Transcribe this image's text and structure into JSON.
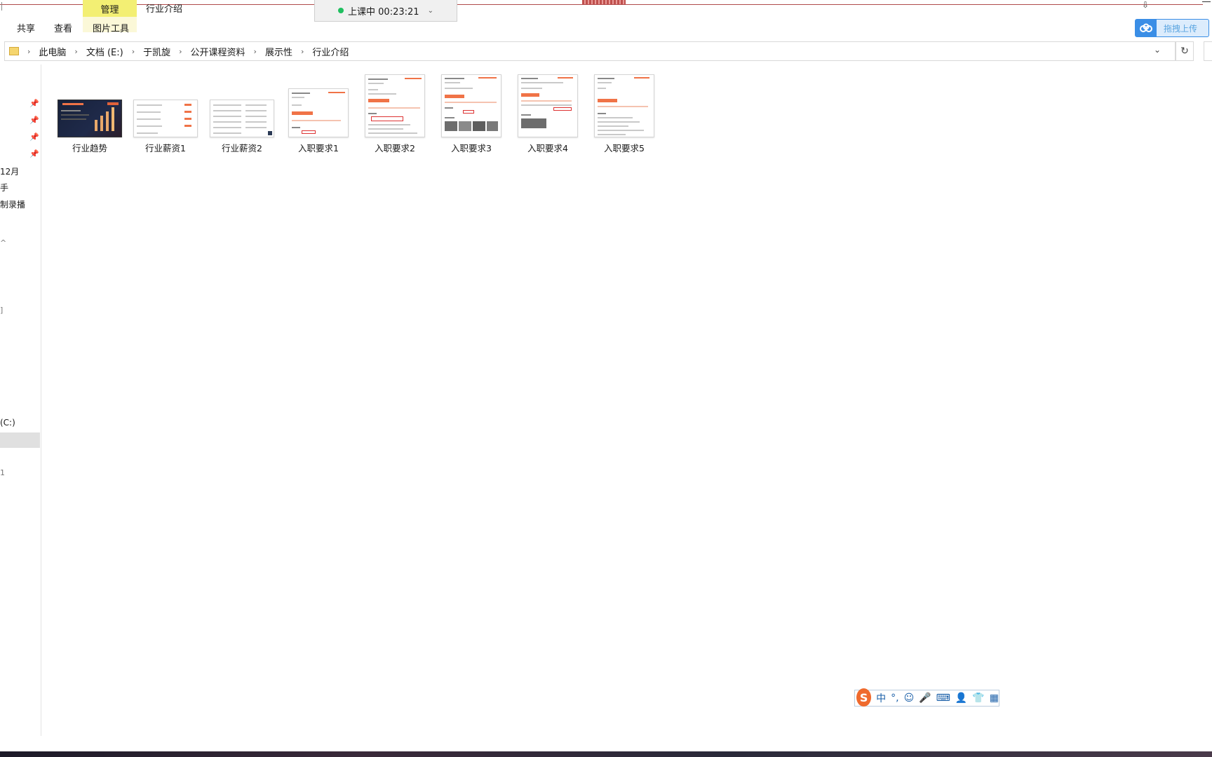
{
  "window": {
    "title": "行业介绍",
    "context_tab": "管理",
    "scroll_glyph": "⇩"
  },
  "class_indicator": {
    "label": "上课中 00:23:21",
    "status_color": "#1fbf5f",
    "chevron": "⌄"
  },
  "ribbon": {
    "tabs": [
      "共享",
      "查看",
      "图片工具"
    ]
  },
  "upload_button": {
    "label": "拖拽上传",
    "icon": "cloud-icon",
    "accent": "#3a8ee6"
  },
  "address_bar": {
    "segments": [
      "此电脑",
      "文档 (E:)",
      "于凯旋",
      "公开课程资料",
      "展示性",
      "行业介绍"
    ],
    "separator": "›",
    "dropdown": "⌄",
    "refresh": "↻"
  },
  "nav_pane": {
    "items": [
      "12月",
      "手",
      "制录播",
      "(C:)"
    ],
    "pin_icon": "📌",
    "marks": [
      "^",
      "]",
      "1"
    ]
  },
  "files": [
    {
      "name": "行业趋势",
      "kind": "landscape-dark"
    },
    {
      "name": "行业薪资1",
      "kind": "landscape"
    },
    {
      "name": "行业薪资2",
      "kind": "landscape"
    },
    {
      "name": "入职要求1",
      "kind": "portrait"
    },
    {
      "name": "入职要求2",
      "kind": "portrait"
    },
    {
      "name": "入职要求3",
      "kind": "portrait"
    },
    {
      "name": "入职要求4",
      "kind": "portrait"
    },
    {
      "name": "入职要求5",
      "kind": "portrait"
    }
  ],
  "ime_toolbar": {
    "logo": "S",
    "items": [
      "中",
      "°,",
      "☺",
      "🎤",
      "⌨",
      "👤",
      "👕",
      "▦"
    ]
  },
  "colors": {
    "accent_orange": "#f07347",
    "context_tab_bg": "#f3ef73"
  }
}
